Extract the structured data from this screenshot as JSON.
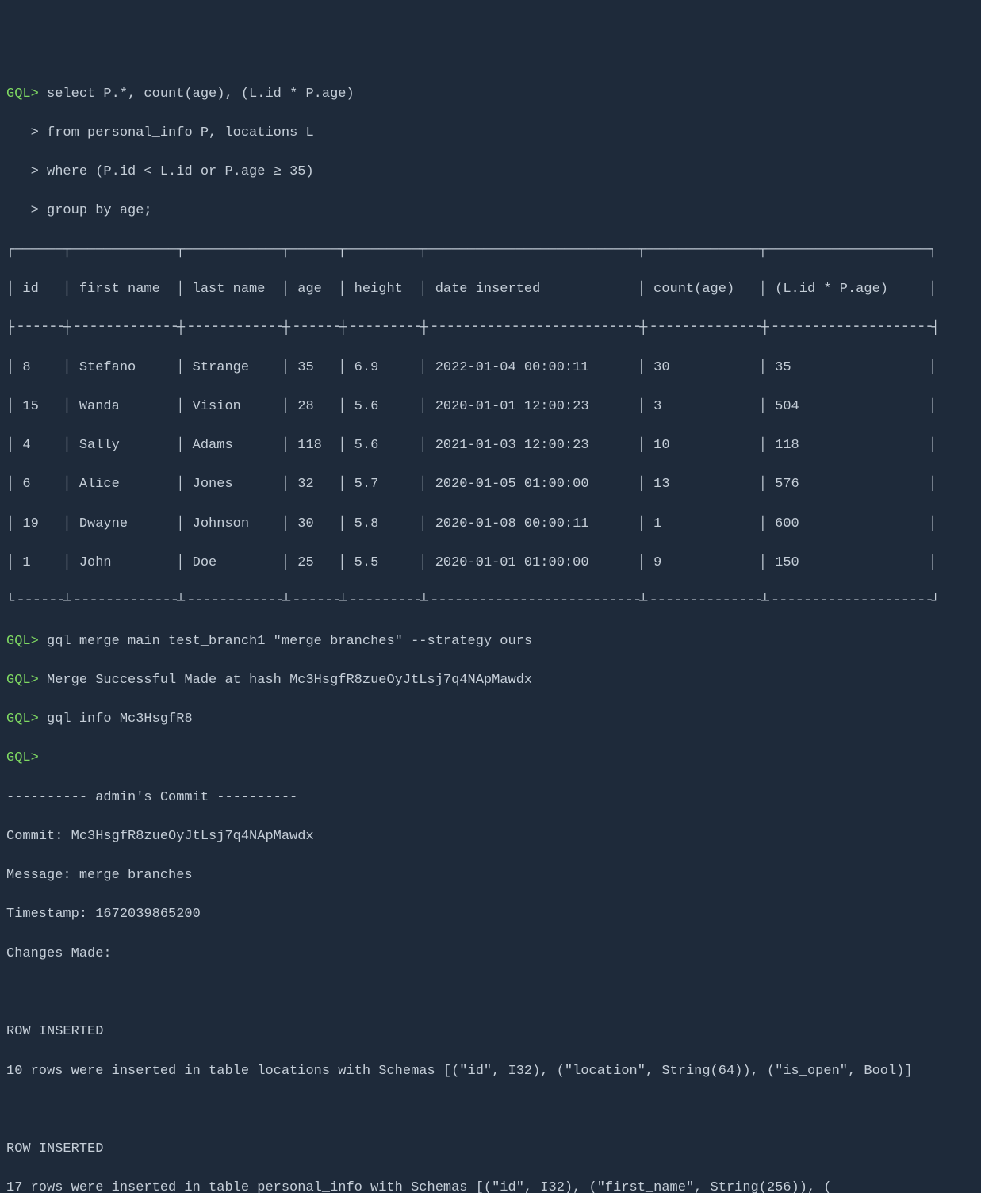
{
  "prompt": "GQL>",
  "cont_prompt": "   >",
  "query": {
    "l1": " select P.*, count(age), (L.id * P.age)",
    "l2": " from personal_info P, locations L",
    "l3": " where (P.id < L.id or P.age ≥ 35)",
    "l4": " group by age;"
  },
  "table": {
    "top": "┌──────┬─────────────┬────────────┬──────┬─────────┬──────────────────────────┬──────────────┬────────────────────┐",
    "sep": "├╶╶╶╶╶╶┼╶╶╶╶╶╶╶╶╶╶╶╶╶┼╶╶╶╶╶╶╶╶╶╶╶╶┼╶╶╶╶╶╶┼╶╶╶╶╶╶╶╶╶┼╶╶╶╶╶╶╶╶╶╶╶╶╶╶╶╶╶╶╶╶╶╶╶╶╶╶┼╶╶╶╶╶╶╶╶╶╶╶╶╶╶┼╶╶╶╶╶╶╶╶╶╶╶╶╶╶╶╶╶╶╶╶┤",
    "bot": "└╶╶╶╶╶╶┴╶╶╶╶╶╶╶╶╶╶╶╶╶┴╶╶╶╶╶╶╶╶╶╶╶╶┴╶╶╶╶╶╶┴╶╶╶╶╶╶╶╶╶┴╶╶╶╶╶╶╶╶╶╶╶╶╶╶╶╶╶╶╶╶╶╶╶╶╶╶┴╶╶╶╶╶╶╶╶╶╶╶╶╶╶┴╶╶╶╶╶╶╶╶╶╶╶╶╶╶╶╶╶╶╶╶┘",
    "header": "│ id   │ first_name  │ last_name  │ age  │ height  │ date_inserted            │ count(age)   │ (L.id * P.age)     │",
    "rows": [
      "│ 8    │ Stefano     │ Strange    │ 35   │ 6.9     │ 2022-01-04 00:00:11      │ 30           │ 35                 │",
      "│ 15   │ Wanda       │ Vision     │ 28   │ 5.6     │ 2020-01-01 12:00:23      │ 3            │ 504                │",
      "│ 4    │ Sally       │ Adams      │ 118  │ 5.6     │ 2021-01-03 12:00:23      │ 10           │ 118                │",
      "│ 6    │ Alice       │ Jones      │ 32   │ 5.7     │ 2020-01-05 01:00:00      │ 13           │ 576                │",
      "│ 19   │ Dwayne      │ Johnson    │ 30   │ 5.8     │ 2020-01-08 00:00:11      │ 1            │ 600                │",
      "│ 1    │ John        │ Doe        │ 25   │ 5.5     │ 2020-01-01 01:00:00      │ 9            │ 150                │"
    ]
  },
  "chart_data": {
    "type": "table",
    "columns": [
      "id",
      "first_name",
      "last_name",
      "age",
      "height",
      "date_inserted",
      "count(age)",
      "(L.id * P.age)"
    ],
    "rows": [
      [
        8,
        "Stefano",
        "Strange",
        35,
        6.9,
        "2022-01-04 00:00:11",
        30,
        35
      ],
      [
        15,
        "Wanda",
        "Vision",
        28,
        5.6,
        "2020-01-01 12:00:23",
        3,
        504
      ],
      [
        4,
        "Sally",
        "Adams",
        118,
        5.6,
        "2021-01-03 12:00:23",
        10,
        118
      ],
      [
        6,
        "Alice",
        "Jones",
        32,
        5.7,
        "2020-01-05 01:00:00",
        13,
        576
      ],
      [
        19,
        "Dwayne",
        "Johnson",
        30,
        5.8,
        "2020-01-08 00:00:11",
        1,
        600
      ],
      [
        1,
        "John",
        "Doe",
        25,
        5.5,
        "2020-01-01 01:00:00",
        9,
        150
      ]
    ]
  },
  "cmd2": " gql merge main test_branch1 \"merge branches\" --strategy ours",
  "merge_result": " Merge Successful Made at hash Mc3HsgfR8zueOyJtLsj7q4NApMawdx",
  "cmd3": " gql info Mc3HsgfR8",
  "commit_info": {
    "header": "---------- admin's Commit ----------",
    "hash": "Commit: Mc3HsgfR8zueOyJtLsj7q4NApMawdx",
    "message": "Message: merge branches",
    "timestamp": "Timestamp: 1672039865200",
    "changes": "Changes Made:",
    "row_ins1_label": "ROW INSERTED",
    "row_ins1_text": "10 rows were inserted in table locations with Schemas [(\"id\", I32), (\"location\", String(64)), (\"is_open\", Bool)]",
    "row_ins2_label": "ROW INSERTED",
    "row_ins2_text": "17 rows were inserted in table personal_info with Schemas [(\"id\", I32), (\"first_name\", String(256)), ("
  }
}
